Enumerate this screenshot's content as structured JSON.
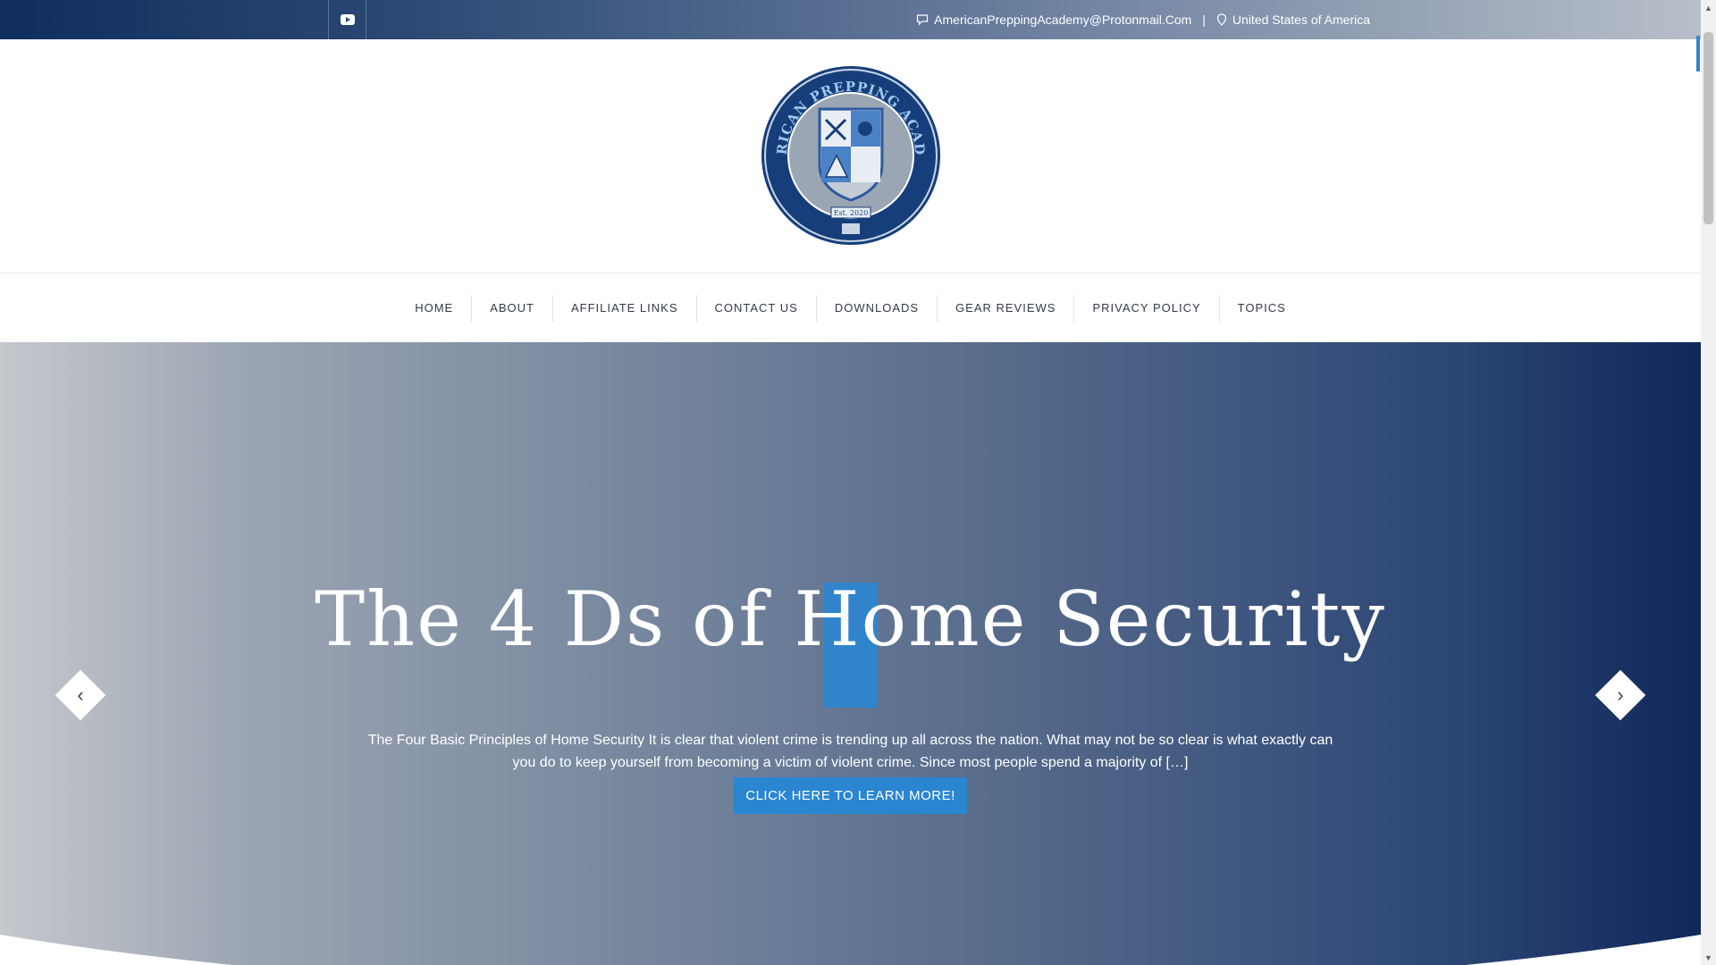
{
  "topbar": {
    "youtube_icon": "youtube-icon",
    "email": "AmericanPreppingAcademy@Protonmail.Com",
    "separator": "|",
    "location": "United States of America"
  },
  "logo": {
    "text_top": "AMERICAN PREPPING ACADEMY",
    "established": "Est. 2020"
  },
  "nav": {
    "items": [
      {
        "label": "HOME"
      },
      {
        "label": "ABOUT"
      },
      {
        "label": "AFFILIATE LINKS"
      },
      {
        "label": "CONTACT US"
      },
      {
        "label": "DOWNLOADS"
      },
      {
        "label": "GEAR REVIEWS"
      },
      {
        "label": "PRIVACY POLICY"
      },
      {
        "label": "TOPICS"
      }
    ]
  },
  "hero": {
    "title": "The 4 Ds of Home Security",
    "description": "The Four Basic Principles of Home Security   It is clear that violent crime is trending up all across the nation. What may not be so clear is what exactly can you do to keep yourself from becoming a victim of violent crime. Since most people spend a majority of […]",
    "button_label": "CLICK HERE TO LEARN MORE!",
    "prev_icon": "chevron-left-icon",
    "next_icon": "chevron-right-icon"
  },
  "colors": {
    "accent": "#2a86d1",
    "navy": "#10285a",
    "nav_text": "#333a46"
  }
}
